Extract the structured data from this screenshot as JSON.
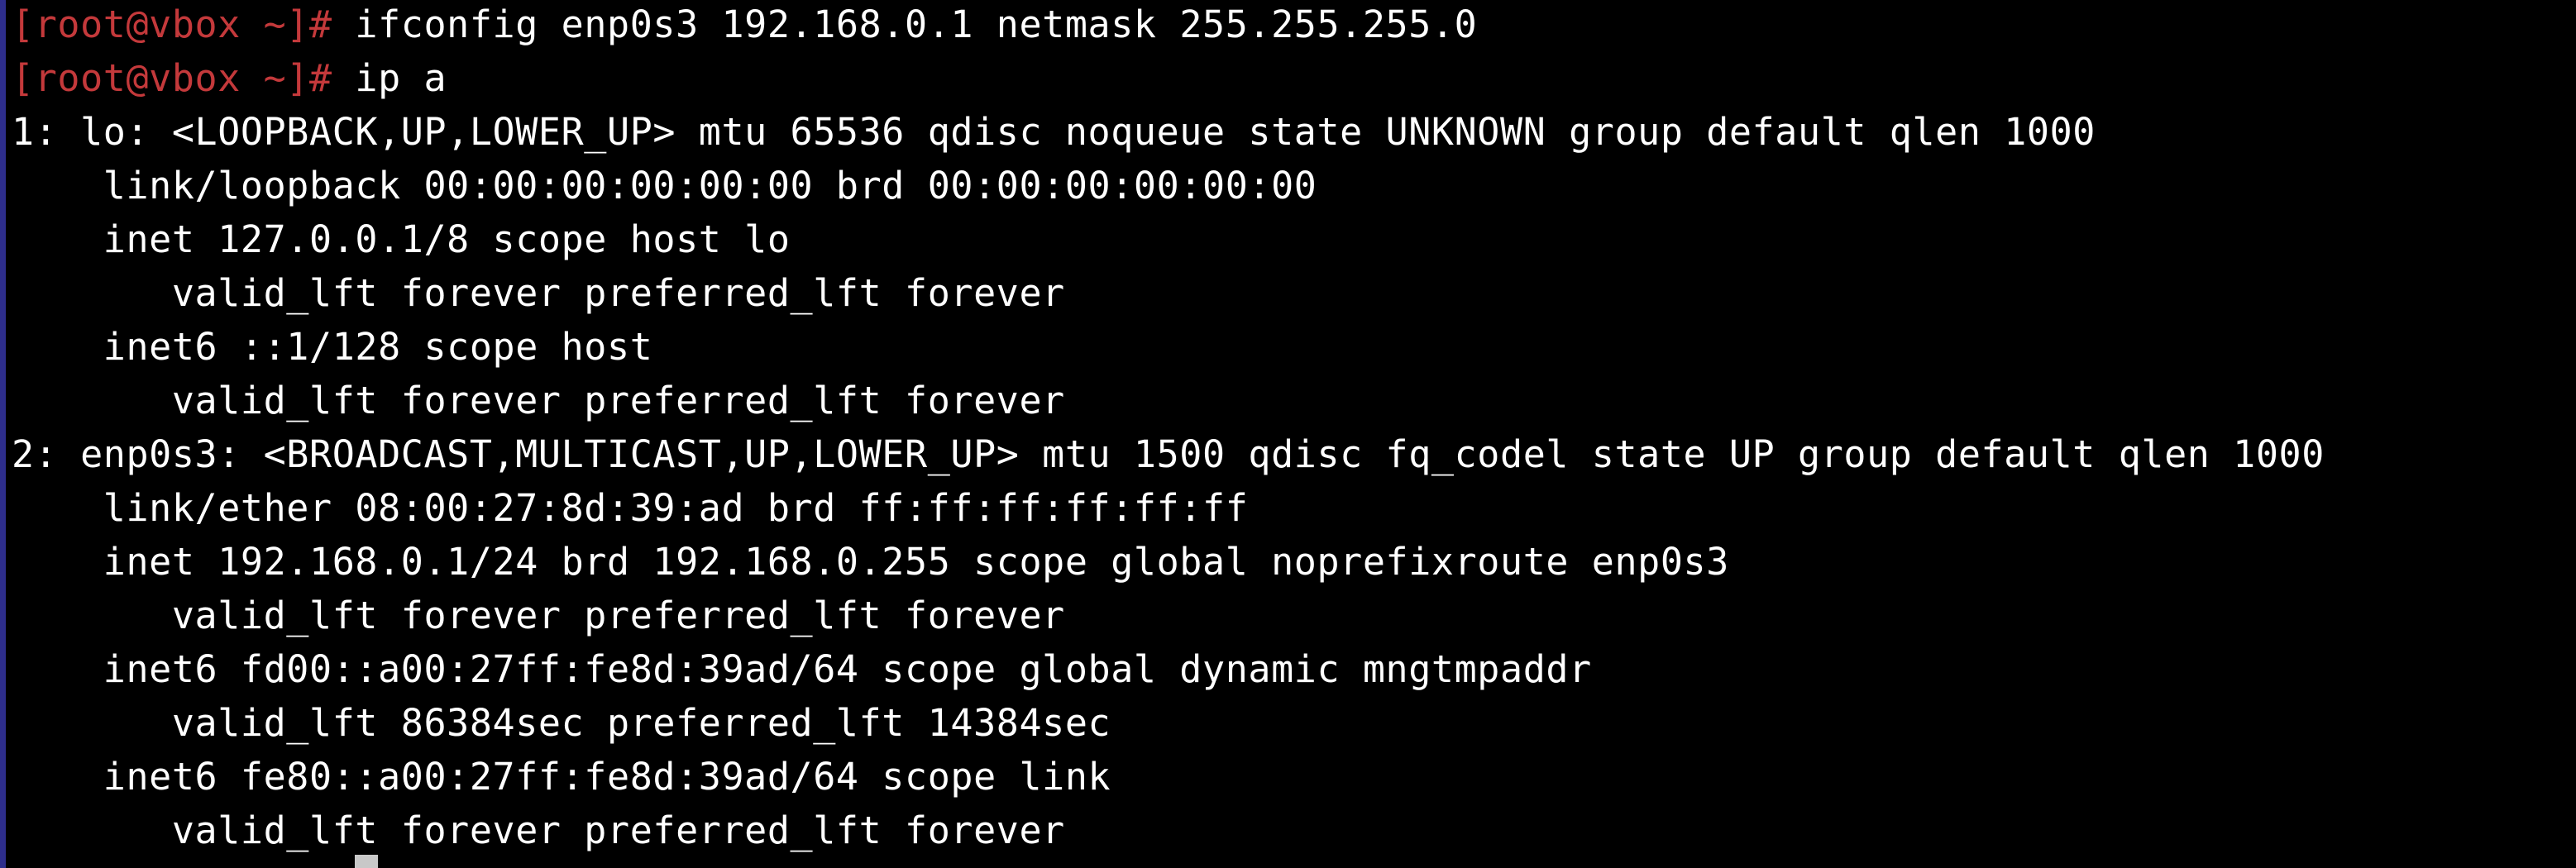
{
  "terminal": {
    "prompt": "[root@vbox ~]#",
    "lines": [
      {
        "prompt": "[root@vbox ~]#",
        "text": " ifconfig enp0s3 192.168.0.1 netmask 255.255.255.0"
      },
      {
        "prompt": "[root@vbox ~]#",
        "text": " ip a"
      },
      {
        "text": "1: lo: <LOOPBACK,UP,LOWER_UP> mtu 65536 qdisc noqueue state UNKNOWN group default qlen 1000"
      },
      {
        "text": "    link/loopback 00:00:00:00:00:00 brd 00:00:00:00:00:00"
      },
      {
        "text": "    inet 127.0.0.1/8 scope host lo"
      },
      {
        "text": "       valid_lft forever preferred_lft forever"
      },
      {
        "text": "    inet6 ::1/128 scope host"
      },
      {
        "text": "       valid_lft forever preferred_lft forever"
      },
      {
        "text": "2: enp0s3: <BROADCAST,MULTICAST,UP,LOWER_UP> mtu 1500 qdisc fq_codel state UP group default qlen 1000"
      },
      {
        "text": "    link/ether 08:00:27:8d:39:ad brd ff:ff:ff:ff:ff:ff"
      },
      {
        "text": "    inet 192.168.0.1/24 brd 192.168.0.255 scope global noprefixroute enp0s3"
      },
      {
        "text": "       valid_lft forever preferred_lft forever"
      },
      {
        "text": "    inet6 fd00::a00:27ff:fe8d:39ad/64 scope global dynamic mngtmpaddr"
      },
      {
        "text": "       valid_lft 86384sec preferred_lft 14384sec"
      },
      {
        "text": "    inet6 fe80::a00:27ff:fe8d:39ad/64 scope link"
      },
      {
        "text": "       valid_lft forever preferred_lft forever"
      }
    ]
  },
  "colors": {
    "background": "#000000",
    "prompt": "#c4393b",
    "text": "#ffffff",
    "cursor": "#c8c8c8",
    "left_edge": "#2e2e8c"
  }
}
